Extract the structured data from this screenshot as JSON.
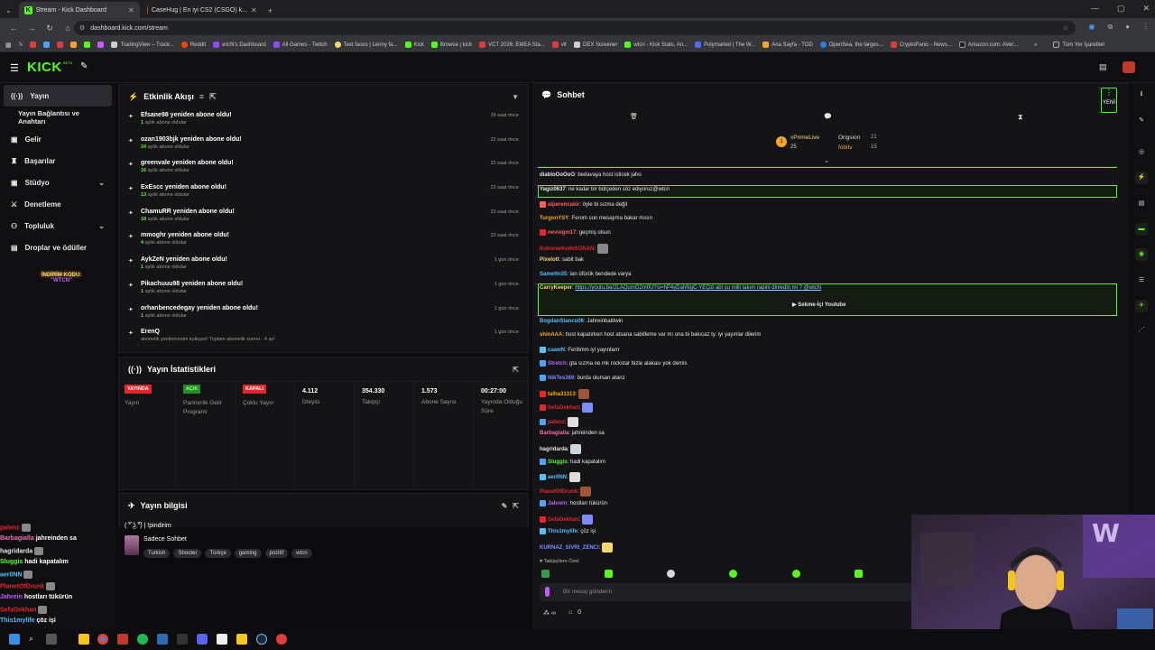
{
  "browser": {
    "tabs": [
      {
        "label": "Stream - Kick Dashboard"
      },
      {
        "label": "CaseHug | En iyi CS2 (CSGO) k..."
      }
    ],
    "url": "dashboard.kick.com/stream",
    "bookmarks": [
      "TradingView – Track...",
      "Reddit",
      "wtcN's Dashboard",
      "All Games - Twitch",
      "Text faces | Lenny fa...",
      "Kick",
      "Browse | kick",
      "VCT 2026: EMEA Sta...",
      "vlr",
      "DEX Screener",
      "wtcn - Kick Stats, An...",
      "Polymarket | The W...",
      "Ana Sayfa - TOD",
      "OpenSea, the larges...",
      "CryptoPanic - News...",
      "Amazon.com: AVer..."
    ],
    "bookmarks_more": "Tüm Yer İşaretleri"
  },
  "kick": {
    "logo": "KICK",
    "beta": "BETA"
  },
  "sidebar": {
    "items": [
      {
        "label": "Yayın"
      },
      {
        "label": "Yayın Bağlantısı ve Anahtarı"
      },
      {
        "label": "Gelir"
      },
      {
        "label": "Başarılar"
      },
      {
        "label": "Stüdyo"
      },
      {
        "label": "Denetleme"
      },
      {
        "label": "Topluluk"
      },
      {
        "label": "Droplar ve ödüller"
      }
    ],
    "promo": {
      "line1": "İNDİRİM KODU:",
      "line2": "\"WTCN\""
    }
  },
  "activity": {
    "title": "Etkinlik Akışı",
    "events": [
      {
        "title": "Efsane98 yeniden abone oldu!",
        "months": "1",
        "suffix": "aylık abone oldular",
        "time": "19 saat önce"
      },
      {
        "title": "ozan1903bjk yeniden abone oldu!",
        "months": "24",
        "suffix": "aylık abone oldular",
        "time": "22 saat önce"
      },
      {
        "title": "greenvale yeniden abone oldu!",
        "months": "16",
        "suffix": "aylık abone oldular",
        "time": "22 saat önce"
      },
      {
        "title": "ExEscc yeniden abone oldu!",
        "months": "13",
        "suffix": "aylık abone oldular",
        "time": "23 saat önce"
      },
      {
        "title": "ChamuRR yeniden abone oldu!",
        "months": "18",
        "suffix": "aylık abone oldular",
        "time": "23 saat önce"
      },
      {
        "title": "mmoghr yeniden abone oldu!",
        "months": "4",
        "suffix": "aylık abone oldular",
        "time": "23 saat önce"
      },
      {
        "title": "AykZeN yeniden abone oldu!",
        "months": "1",
        "suffix": "aylık abone oldular",
        "time": "1 gün önce"
      },
      {
        "title": "Pikachuuu98 yeniden abone oldu!",
        "months": "1",
        "suffix": "aylık abone oldular",
        "time": "1 gün önce"
      },
      {
        "title": "orhanbencedegay yeniden abone oldu!",
        "months": "1",
        "suffix": "aylık abone oldular",
        "time": "1 gün önce"
      },
      {
        "title": "ErenQ",
        "months": "",
        "suffix": "abonelik yenilemesini kutluyor! Toplam abonelik süresi - 4 ay!",
        "time": "1 gün önce"
      }
    ]
  },
  "stats": {
    "title": "Yayın İstatistikleri",
    "cells": [
      {
        "badge": "YAYINDA",
        "badge_color": "#e5252c",
        "label": "Yayın"
      },
      {
        "badge": "AÇIK",
        "badge_color": "#1f8f2a",
        "label": "Partnerlik Gelir Programı"
      },
      {
        "badge": "KAPALI",
        "badge_color": "#e5252c",
        "label": "Çoklu Yayın"
      },
      {
        "value": "4.112",
        "label": "İzleyici"
      },
      {
        "value": "354.330",
        "label": "Takipçi"
      },
      {
        "value": "1.573",
        "label": "Abone Sayısı"
      },
      {
        "value": "00:27:00",
        "label": "Yayında Olduğu Süre"
      }
    ]
  },
  "info": {
    "title": "Yayın bilgisi",
    "stream_title": "( ͡° ͜ʖ ͡°) | !pindirim",
    "category": "Sadece Sohbet",
    "tags": [
      "Turkish",
      "Shooter",
      "Türkçe",
      "gaming",
      "pozitif",
      "wtcn"
    ]
  },
  "chat": {
    "title": "Sohbet",
    "new_label": "YENİ",
    "gifters": [
      {
        "name": "xPrimeLive",
        "count": "25"
      },
      {
        "name": "Origsion",
        "count": "21"
      },
      {
        "name": "fobitv",
        "count": "15"
      }
    ],
    "messages": [
      {
        "user": "diabloOoOoO",
        "text": "bedavaya host isticek jaho",
        "color": "#e6e6e6"
      },
      {
        "user": "Yagiz0637",
        "text": "ne kadar bir bütçeden söz ediyoruz@wtcn",
        "color": "#e6e6e6"
      },
      {
        "user": "alperencakir",
        "text": "öyle bi sızma değil",
        "color": "#ff5f57"
      },
      {
        "user": "TurgonYSY",
        "text": "Ferom son mesajıma bakar mısın",
        "color": "#f5a623"
      },
      {
        "user": "nevoigm17",
        "text": "geçmiş olsun",
        "color": "#ff5f57"
      },
      {
        "user": "KokoreeKedeSOKAN",
        "text": "",
        "color": "#e5252c"
      },
      {
        "user": "Pixelott",
        "text": "sabit bak",
        "color": "#f5d76e"
      },
      {
        "user": "Samettn35",
        "text": "ian üfürük bendede varya",
        "color": "#53c0fc"
      },
      {
        "user": "CarryKeeper",
        "text": "https://youtu.be/2LAQumG2m0U?si=hP4yDahNgC-YEQzi abi şu milli takım rapini dinledin mi ? @wtcN",
        "color": "#f5d76e"
      },
      {
        "user": "",
        "text": "Sekme-İçi Youtube",
        "color": "#e6e6e6"
      },
      {
        "user": "BogdanStancu06",
        "text": "Jahreinbaldwin",
        "color": "#53c0fc"
      },
      {
        "user": "shinAAA",
        "text": "host kapatırken host atsana sabitleme var mı ona bi bakıcaz ty. iyi yayınlar dilerim",
        "color": "#f5a623"
      },
      {
        "user": "caawN",
        "text": "Feritimm iyi yayınlarrr",
        "color": "#53c0fc"
      },
      {
        "user": "Stretch",
        "text": "gta sızma ne mk rockstar bizle alakası yok demis",
        "color": "#c55cff"
      },
      {
        "user": "NikTes369",
        "text": "burda olursan atanz",
        "color": "#7b8cff"
      },
      {
        "user": "talha31313",
        "text": "",
        "color": "#f5a623"
      },
      {
        "user": "SefaOekhan",
        "text": "",
        "color": "#e5252c"
      },
      {
        "user": "palenz",
        "text": "",
        "color": "#e5252c"
      },
      {
        "user": "Barbagialla",
        "text": "jahreinden sa",
        "color": "#f06ea9"
      },
      {
        "user": "hagridarda",
        "text": "",
        "color": "#e6e6e6"
      },
      {
        "user": "Sluggis",
        "text": "hadi kapatalım",
        "color": "#53fc18"
      },
      {
        "user": "aer0NN",
        "text": "",
        "color": "#53c0fc"
      },
      {
        "user": "PlanetOfDrunk",
        "text": "",
        "color": "#e5252c"
      },
      {
        "user": "Jahrein",
        "text": "hostları tükürün",
        "color": "#c55cff"
      },
      {
        "user": "SefaOekhan",
        "text": "",
        "color": "#e5252c"
      },
      {
        "user": "This1mylife",
        "text": "çöz işi",
        "color": "#53c0fc"
      },
      {
        "user": "KURNAZ_SIVRI_ZENCI",
        "text": "",
        "color": "#7b8cff"
      }
    ],
    "followers_only": "Takipçilere Özel",
    "input_placeholder": "Bir mesaj gönderin",
    "points": "0",
    "chat_ext_value": "∞"
  },
  "overlay_chat": [
    {
      "user": "palenz",
      "text": ""
    },
    {
      "user": "Barbagialla",
      "text": "jahreinden sa"
    },
    {
      "user": "hagridarda",
      "text": ""
    },
    {
      "user": "Sluggis",
      "text": "hadi kapatalım"
    },
    {
      "user": "aer0NN",
      "text": ""
    },
    {
      "user": "PlanetOfDrunk",
      "text": ""
    },
    {
      "user": "Jahrein",
      "text": "hostları tükürün"
    },
    {
      "user": "SefaOekhan",
      "text": ""
    },
    {
      "user": "This1mylife",
      "text": "çöz işi"
    },
    {
      "user": "KURNAZ_SIVRI_ZENCI",
      "text": ""
    }
  ],
  "colors": {
    "accent": "#53fc18",
    "panel": "#141417",
    "bg": "#0b0b0d",
    "live": "#e5252c"
  }
}
